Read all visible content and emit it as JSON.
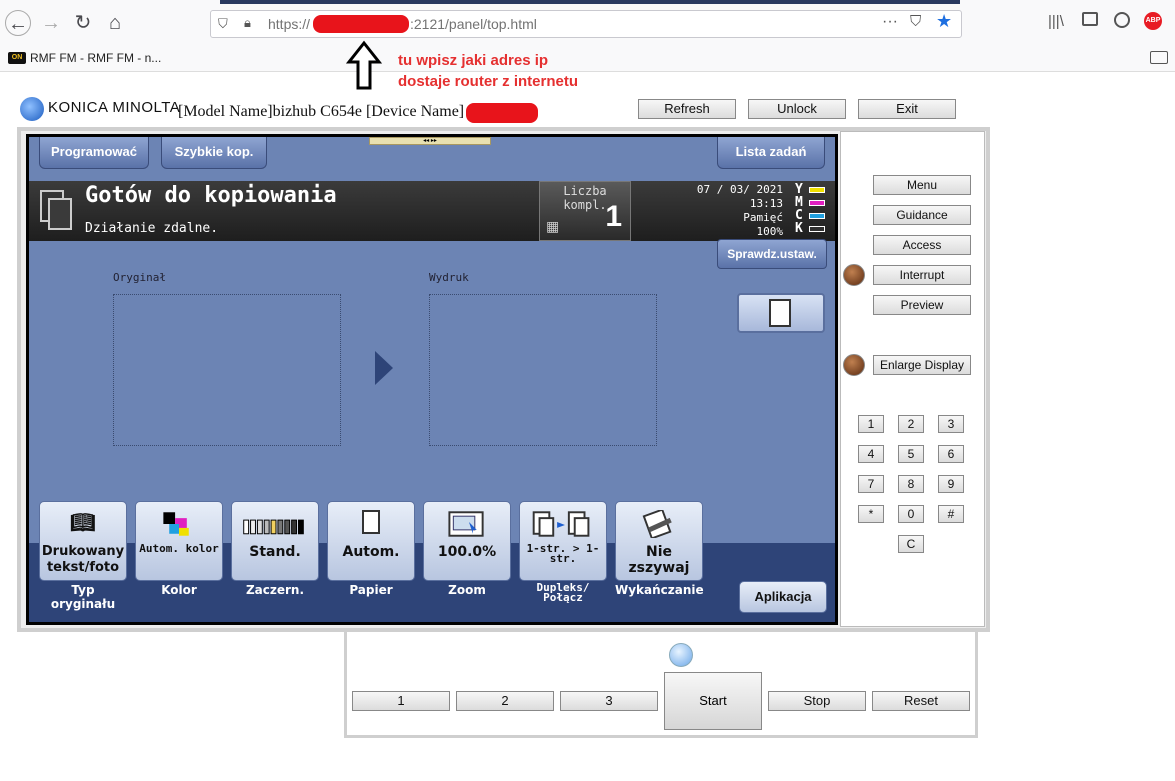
{
  "browser": {
    "url_prefix": "https://",
    "url_suffix": ":2121/panel/top.html",
    "bookmark": "RMF FM - RMF FM - n...",
    "annotation_line1": "tu wpisz jaki adres ip",
    "annotation_line2": "dostaje router z internetu"
  },
  "header": {
    "brand": "KONICA MINOLTA",
    "model_text": "[Model Name]bizhub C654e [Device Name]",
    "buttons": [
      "Refresh",
      "Unlock",
      "Exit"
    ]
  },
  "screen": {
    "top_buttons": [
      "Programować",
      "Szybkie kop.",
      "Lista zadań"
    ],
    "title": "Gotów do kopiowania",
    "subtitle": "Działanie zdalne.",
    "count_label": "Liczba kompl.",
    "count_value": "1",
    "date": "07 / 03/ 2021",
    "time": "13:13",
    "memory_label": "Pamięć",
    "memory_value": "100%",
    "toner_letters": [
      "Y",
      "M",
      "C",
      "K"
    ],
    "toner_colors": [
      "#f0e000",
      "#e020c0",
      "#20a0e0",
      "#303030"
    ],
    "check_settings": "Sprawdz.ustaw.",
    "original_label": "Oryginał",
    "output_label": "Wydruk",
    "functions": [
      {
        "value": "Drukowany tekst/foto",
        "label": "Typ oryginału",
        "icon": "book-icon"
      },
      {
        "value": "Autom. kolor",
        "label": "Kolor",
        "icon": "color-icon"
      },
      {
        "value": "Stand.",
        "label": "Zaczern.",
        "icon": "density-icon"
      },
      {
        "value": "Autom.",
        "label": "Papier",
        "icon": "paper-icon"
      },
      {
        "value": "100.0%",
        "label": "Zoom",
        "icon": "zoom-icon"
      },
      {
        "value": "1-str. > 1-str.",
        "label": "Dupleks/ Połącz",
        "icon": "duplex-icon"
      },
      {
        "value": "Nie zszywaj",
        "label": "Wykańczanie",
        "icon": "staple-icon"
      }
    ],
    "application": "Aplikacja"
  },
  "side": {
    "buttons": [
      "Menu",
      "Guidance",
      "Access",
      "Interrupt",
      "Preview",
      "Enlarge Display"
    ],
    "keypad": [
      "1",
      "2",
      "3",
      "4",
      "5",
      "6",
      "7",
      "8",
      "9",
      "*",
      "0",
      "#",
      "C"
    ]
  },
  "bottom": {
    "buttons": [
      "1",
      "2",
      "3"
    ],
    "start": "Start",
    "stop": "Stop",
    "reset": "Reset"
  }
}
